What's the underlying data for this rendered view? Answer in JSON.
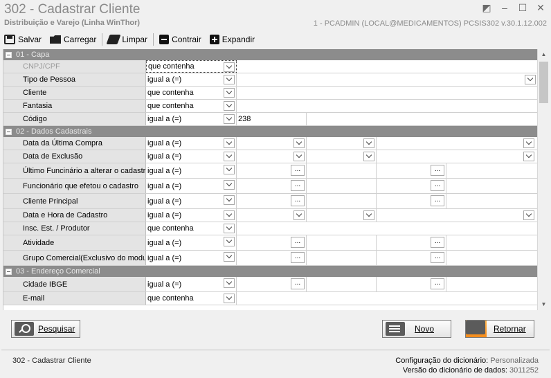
{
  "window": {
    "title": "302 - Cadastrar Cliente",
    "subtitle": "Distribuição e Varejo (Linha WinThor)",
    "connection": "1 - PCADMIN (LOCAL@MEDICAMENTOS)   PCSIS302  v.30.1.12.002",
    "controls": [
      "◩",
      "–",
      "☐",
      "✕"
    ]
  },
  "toolbar": {
    "salvar": "Salvar",
    "carregar": "Carregar",
    "limpar": "Limpar",
    "contrair": "Contrair",
    "expandir": "Expandir"
  },
  "sections": [
    {
      "title": "01 - Capa",
      "rows": [
        {
          "label": "CNPJ/CPF",
          "op": "que contenha",
          "val1": "",
          "disabled": true,
          "layout": "text"
        },
        {
          "label": "Tipo de Pessoa",
          "op": "igual a (=)",
          "val1": "",
          "layout": "combo"
        },
        {
          "label": "Cliente",
          "op": "que contenha",
          "val1": "",
          "layout": "text"
        },
        {
          "label": "Fantasia",
          "op": "que contenha",
          "val1": "",
          "layout": "text"
        },
        {
          "label": "Código",
          "op": "igual a (=)",
          "val1": "238",
          "layout": "range"
        }
      ]
    },
    {
      "title": "02 - Dados Cadastrais",
      "rows": [
        {
          "label": "Data da Última Compra",
          "op": "igual a (=)",
          "layout": "daterange"
        },
        {
          "label": "Data de Exclusão",
          "op": "igual a (=)",
          "layout": "daterange"
        },
        {
          "label": "Último Funcinário a alterar o cadastro",
          "op": "igual a (=)",
          "layout": "lookup"
        },
        {
          "label": "Funcionário que efetou o cadastro",
          "op": "igual a (=)",
          "layout": "lookup"
        },
        {
          "label": "Cliente Principal",
          "op": "igual a (=)",
          "layout": "lookup"
        },
        {
          "label": "Data e Hora de Cadastro",
          "op": "igual a (=)",
          "layout": "daterange"
        },
        {
          "label": "Insc. Est. / Produtor",
          "op": "que contenha",
          "layout": "text"
        },
        {
          "label": "Atividade",
          "op": "igual a (=)",
          "layout": "lookup"
        },
        {
          "label": "Grupo Comercial(Exclusivo do modulo",
          "op": "igual a (=)",
          "layout": "lookup"
        }
      ]
    },
    {
      "title": "03 - Endereço Comercial",
      "rows": [
        {
          "label": "Cidade IBGE",
          "op": "igual a (=)",
          "layout": "lookup"
        },
        {
          "label": "E-mail",
          "op": "que contenha",
          "layout": "text"
        }
      ]
    }
  ],
  "ellipsis": "...",
  "buttons": {
    "pesquisar": "Pesquisar",
    "novo": "Novo",
    "retornar": "Retornar"
  },
  "footer": {
    "screen": "302 - Cadastrar Cliente",
    "config_label": "Configuração do dicionário:",
    "config_value": "Personalizada",
    "version_label": "Versão do dicionário de dados:",
    "version_value": "3011252"
  }
}
